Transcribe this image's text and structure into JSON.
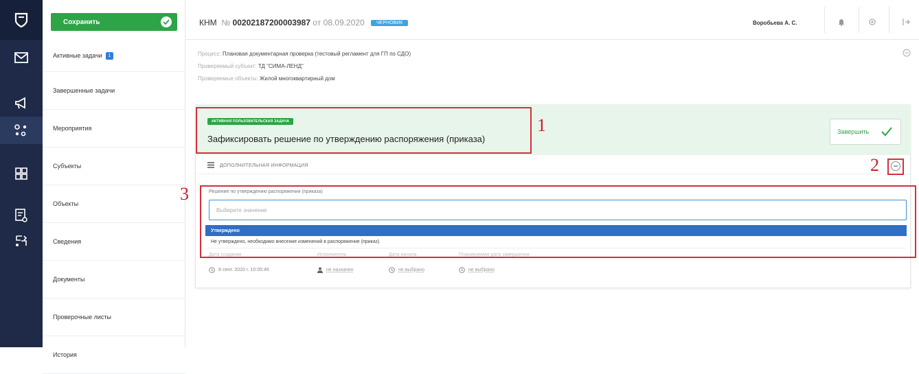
{
  "rail": {
    "icons": [
      "logo-shield-icon",
      "mail-icon",
      "megaphone-icon",
      "hub-icon",
      "grid-icon",
      "report-icon",
      "process-icon"
    ]
  },
  "sidebar": {
    "save_label": "Сохранить",
    "items": [
      {
        "label": "Активные задачи",
        "badge": "1"
      },
      {
        "label": "Завершенные задачи"
      },
      {
        "label": "Мероприятия"
      },
      {
        "label": "Субъекты"
      },
      {
        "label": "Объекты"
      },
      {
        "label": "Сведения"
      },
      {
        "label": "Документы"
      },
      {
        "label": "Проверочные листы"
      },
      {
        "label": "История"
      }
    ]
  },
  "header": {
    "type": "КНМ",
    "number_prefix": "№",
    "number": "00202187200003987",
    "date_prefix": "от",
    "date": "08.09.2020",
    "status": "ЧЕРНОВИК",
    "user": "Воробьева А. С."
  },
  "meta": {
    "process_label": "Процесс:",
    "process_value": "Плановая документарная проверка (тестовый регламент для ГП по СДО)",
    "subject_label": "Проверяемый субъект:",
    "subject_value": "ТД \"СИМА-ЛЕНД\"",
    "objects_label": "Проверяемые объекты:",
    "objects_value": "Жилой многоквартирный дом"
  },
  "task": {
    "tag": "АКТИВНАЯ ПОЛЬЗОВАТЕЛЬСКАЯ ЗАДАЧА",
    "title": "Зафиксировать решение по утверждению распоряжения (приказа)",
    "finish_label": "Завершить",
    "additional_info": "ДОПОЛНИТЕЛЬНАЯ ИНФОРМАЦИЯ"
  },
  "decision": {
    "label": "Решение по утверждению распоряжения (приказа)",
    "placeholder": "Выберите значение",
    "options": [
      "Утверждено",
      "Не утверждено, необходимо внесение изменений в распоряжение (приказ)"
    ]
  },
  "task_meta": {
    "headers": [
      "Дата создания",
      "Исполнитель",
      "Дата начала",
      "Планируемая дата завершения"
    ],
    "created": "8 сент. 2020 г. 10:05:46",
    "assignee": "не назначен",
    "start": "не выбрано",
    "planned_end": "не выбрано"
  },
  "annotations": [
    "1",
    "2",
    "3"
  ],
  "colors": {
    "rail": "#1e2a47",
    "accent_green": "#2da446",
    "select_blue": "#2f6fc5",
    "annotation_red": "#d32f3c"
  }
}
